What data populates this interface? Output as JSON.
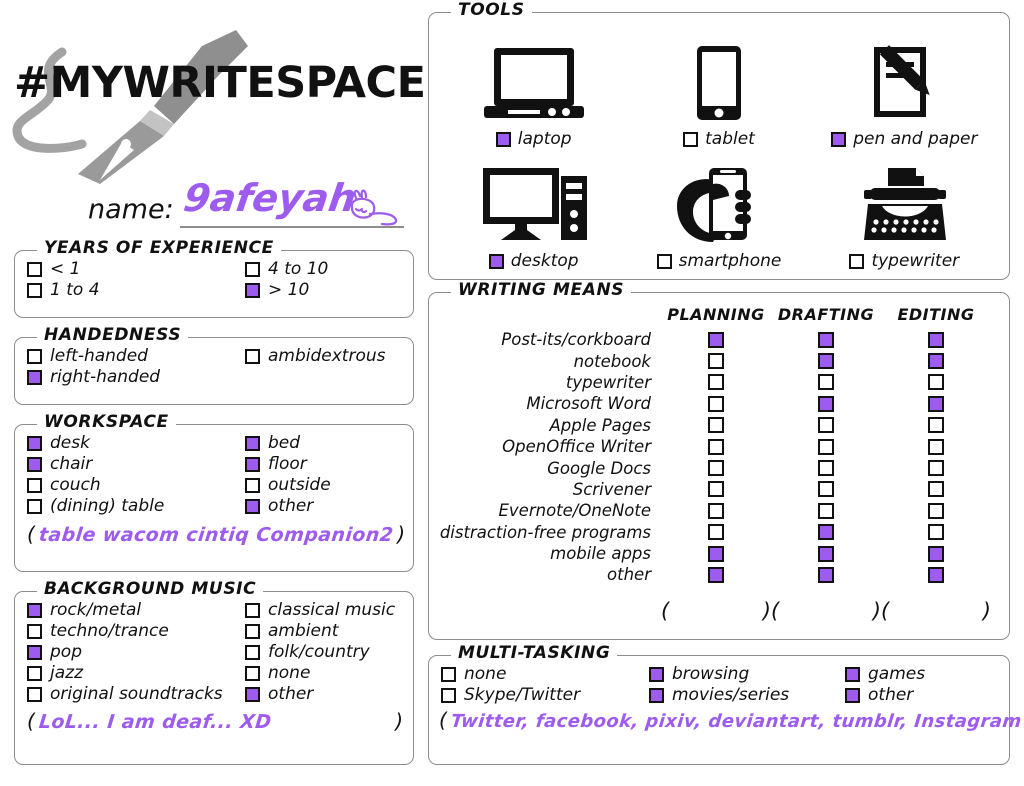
{
  "header": {
    "title": "#MYWRITESPACE",
    "name_label": "name:",
    "name_value": "9afeyah",
    "logo_icon": "fountain-pen-icon",
    "doodle_icon": "bunny-doodle-icon"
  },
  "colors": {
    "accent_purple": "#9d5ced",
    "box_border": "#8d8d8d",
    "ink_black": "#111111",
    "logo_gray": "#9a9a9a"
  },
  "experience": {
    "legend": "YEARS OF EXPERIENCE",
    "left": [
      {
        "label": "< 1",
        "checked": false
      },
      {
        "label": "1 to 4",
        "checked": false
      }
    ],
    "right": [
      {
        "label": "4 to 10",
        "checked": false
      },
      {
        "label": "> 10",
        "checked": true
      }
    ]
  },
  "handedness": {
    "legend": "HANDEDNESS",
    "left": [
      {
        "label": "left-handed",
        "checked": false
      },
      {
        "label": "right-handed",
        "checked": true
      }
    ],
    "right": [
      {
        "label": "ambidextrous",
        "checked": false
      }
    ]
  },
  "workspace": {
    "legend": "WORKSPACE",
    "left": [
      {
        "label": "desk",
        "checked": true
      },
      {
        "label": "chair",
        "checked": true
      },
      {
        "label": "couch",
        "checked": false
      },
      {
        "label": "(dining) table",
        "checked": false
      }
    ],
    "right": [
      {
        "label": "bed",
        "checked": true
      },
      {
        "label": "floor",
        "checked": true
      },
      {
        "label": "outside",
        "checked": false
      },
      {
        "label": "other",
        "checked": true
      }
    ],
    "note_open": "(",
    "note_text": "table wacom cintiq Companion2",
    "note_close": ")"
  },
  "music": {
    "legend": "BACKGROUND MUSIC",
    "left": [
      {
        "label": "rock/metal",
        "checked": true
      },
      {
        "label": "techno/trance",
        "checked": false
      },
      {
        "label": "pop",
        "checked": true
      },
      {
        "label": "jazz",
        "checked": false
      },
      {
        "label": "original soundtracks",
        "checked": false
      }
    ],
    "right": [
      {
        "label": "classical music",
        "checked": false
      },
      {
        "label": "ambient",
        "checked": false
      },
      {
        "label": "folk/country",
        "checked": false
      },
      {
        "label": "none",
        "checked": false
      },
      {
        "label": "other",
        "checked": true
      }
    ],
    "note_open": "(",
    "note_text": "LoL... I am deaf... XD",
    "note_close": ")"
  },
  "tools": {
    "legend": "TOOLS",
    "items": [
      {
        "label": "laptop",
        "checked": true,
        "icon": "laptop-icon"
      },
      {
        "label": "tablet",
        "checked": false,
        "icon": "tablet-icon"
      },
      {
        "label": "pen and paper",
        "checked": true,
        "icon": "pen-and-paper-icon"
      },
      {
        "label": "desktop",
        "checked": true,
        "icon": "desktop-computer-icon"
      },
      {
        "label": "smartphone",
        "checked": false,
        "icon": "smartphone-in-hand-icon"
      },
      {
        "label": "typewriter",
        "checked": false,
        "icon": "typewriter-icon"
      }
    ]
  },
  "writing_means": {
    "legend": "WRITING MEANS",
    "columns": [
      "PLANNING",
      "DRAFTING",
      "EDITING"
    ],
    "rows": [
      {
        "label": "Post-its/corkboard",
        "values": [
          true,
          true,
          true
        ]
      },
      {
        "label": "notebook",
        "values": [
          false,
          true,
          true
        ]
      },
      {
        "label": "typewriter",
        "values": [
          false,
          false,
          false
        ]
      },
      {
        "label": "Microsoft Word",
        "values": [
          false,
          true,
          true
        ]
      },
      {
        "label": "Apple Pages",
        "values": [
          false,
          false,
          false
        ]
      },
      {
        "label": "OpenOffice Writer",
        "values": [
          false,
          false,
          false
        ]
      },
      {
        "label": "Google Docs",
        "values": [
          false,
          false,
          false
        ]
      },
      {
        "label": "Scrivener",
        "values": [
          false,
          false,
          false
        ]
      },
      {
        "label": "Evernote/OneNote",
        "values": [
          false,
          false,
          false
        ]
      },
      {
        "label": "distraction-free programs",
        "values": [
          false,
          true,
          false
        ]
      },
      {
        "label": "mobile apps",
        "values": [
          true,
          true,
          true
        ]
      },
      {
        "label": "other",
        "values": [
          true,
          true,
          true
        ]
      }
    ],
    "other_notes": [
      {
        "open": "(",
        "text": "",
        "close": ")"
      },
      {
        "open": "(",
        "text": "",
        "close": ")"
      },
      {
        "open": "(",
        "text": "",
        "close": ")"
      }
    ]
  },
  "multitasking": {
    "legend": "MULTI-TASKING",
    "col1": [
      {
        "label": "none",
        "checked": false
      },
      {
        "label": "Skype/Twitter",
        "checked": false
      }
    ],
    "col2": [
      {
        "label": "browsing",
        "checked": true
      },
      {
        "label": "movies/series",
        "checked": true
      }
    ],
    "col3": [
      {
        "label": "games",
        "checked": true
      },
      {
        "label": "other",
        "checked": true
      }
    ],
    "note_open": "(",
    "note_text": "Twitter, facebook, pixiv, deviantart, tumblr, Instagram",
    "note_close": ")"
  }
}
